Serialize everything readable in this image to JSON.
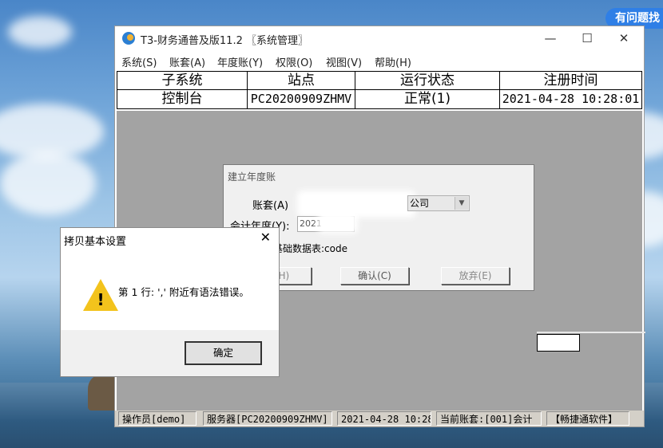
{
  "window": {
    "title": "T3-财务通普及版11.2 〖系统管理〗",
    "controls": {
      "minimize": "—",
      "maximize": "☐",
      "close": "✕"
    }
  },
  "menu": [
    "系统(S)",
    "账套(A)",
    "年度账(Y)",
    "权限(O)",
    "视图(V)",
    "帮助(H)"
  ],
  "grid": {
    "headers": [
      "子系统",
      "站点",
      "运行状态",
      "注册时间"
    ],
    "rows": [
      [
        "控制台",
        "PC20200909ZHMV",
        "正常(1)",
        "2021-04-28 10:28:01"
      ]
    ]
  },
  "statusbar": [
    "操作员[demo]",
    "服务器[PC20200909ZHMV]",
    "2021-04-28 10:28",
    "当前账套:[001]会计",
    "【畅捷通软件】"
  ],
  "badge": "有问题找",
  "year_dialog": {
    "title": "建立年度账",
    "account_label": "账套(A)",
    "account_value": "公司",
    "year_label": "会计年度(Y):",
    "year_value": "2021",
    "basic_data": "基础数据表:code",
    "buttons": [
      "助(H)",
      "确认(C)",
      "放弃(E)"
    ]
  },
  "copy_dialog": {
    "title": "拷贝基本设置",
    "close": "✕",
    "icon": "warning-icon",
    "message": "第 1 行: ',' 附近有语法错误。",
    "ok": "确定"
  },
  "colors": {
    "accent": "#2f7fe6",
    "gray_area": "#a3a3a3",
    "warning": "#f3c31c"
  }
}
